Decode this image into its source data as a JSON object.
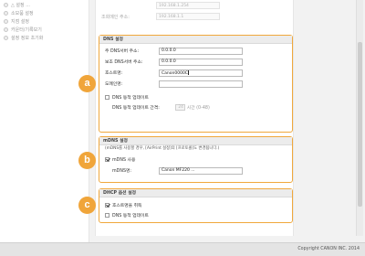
{
  "sidebar": {
    "items": [
      {
        "label": "△ 설정 ..."
      },
      {
        "label": "소모품 설정"
      },
      {
        "label": "지점 설정"
      },
      {
        "label": "카운터/기록보기"
      },
      {
        "label": "설정 정보 초기화"
      }
    ]
  },
  "top_rows": [
    {
      "label": "",
      "value": "192.168.1.254"
    },
    {
      "label": "조회메인 주소:",
      "value": "192.168.1.1"
    }
  ],
  "dns": {
    "title": "DNS 설정",
    "primary_label": "주 DNS서버 주소:",
    "primary_value": "0.0.0.0",
    "secondary_label": "보조 DNS서버 주소:",
    "secondary_value": "0.0.0.0",
    "host_label": "호스트명:",
    "host_value": "Canon0000C",
    "domain_label": "도메인명:",
    "domain_value": "",
    "dynamic_update_label": "DNS 동적 업데이트",
    "dynamic_update_checked": false,
    "interval_label": "DNS 동적 업데이트 간격:",
    "interval_value": "24",
    "interval_unit": "시간 (0-48)"
  },
  "mdns": {
    "title": "mDNS 설정",
    "note": "(mDNS를 사용할 경우, [AirPrint 설정]의 [프로토콜]도 변경됩니다.)",
    "use_label": "mDNS 사용",
    "use_checked": true,
    "name_label": "mDNS명:",
    "name_value": "Canon MF220 ..."
  },
  "dhcp": {
    "title": "DHCP 옵션 설정",
    "hostname_label": "호스트명을 취득",
    "hostname_checked": true,
    "dns_update_label": "DNS 동적 업데이트",
    "dns_update_checked": false
  },
  "badges": {
    "a": "a",
    "b": "b",
    "c": "c"
  },
  "footer": {
    "copyright": "Copyright CANON INC. 2014"
  },
  "colors": {
    "accent": "#f0a53a"
  }
}
